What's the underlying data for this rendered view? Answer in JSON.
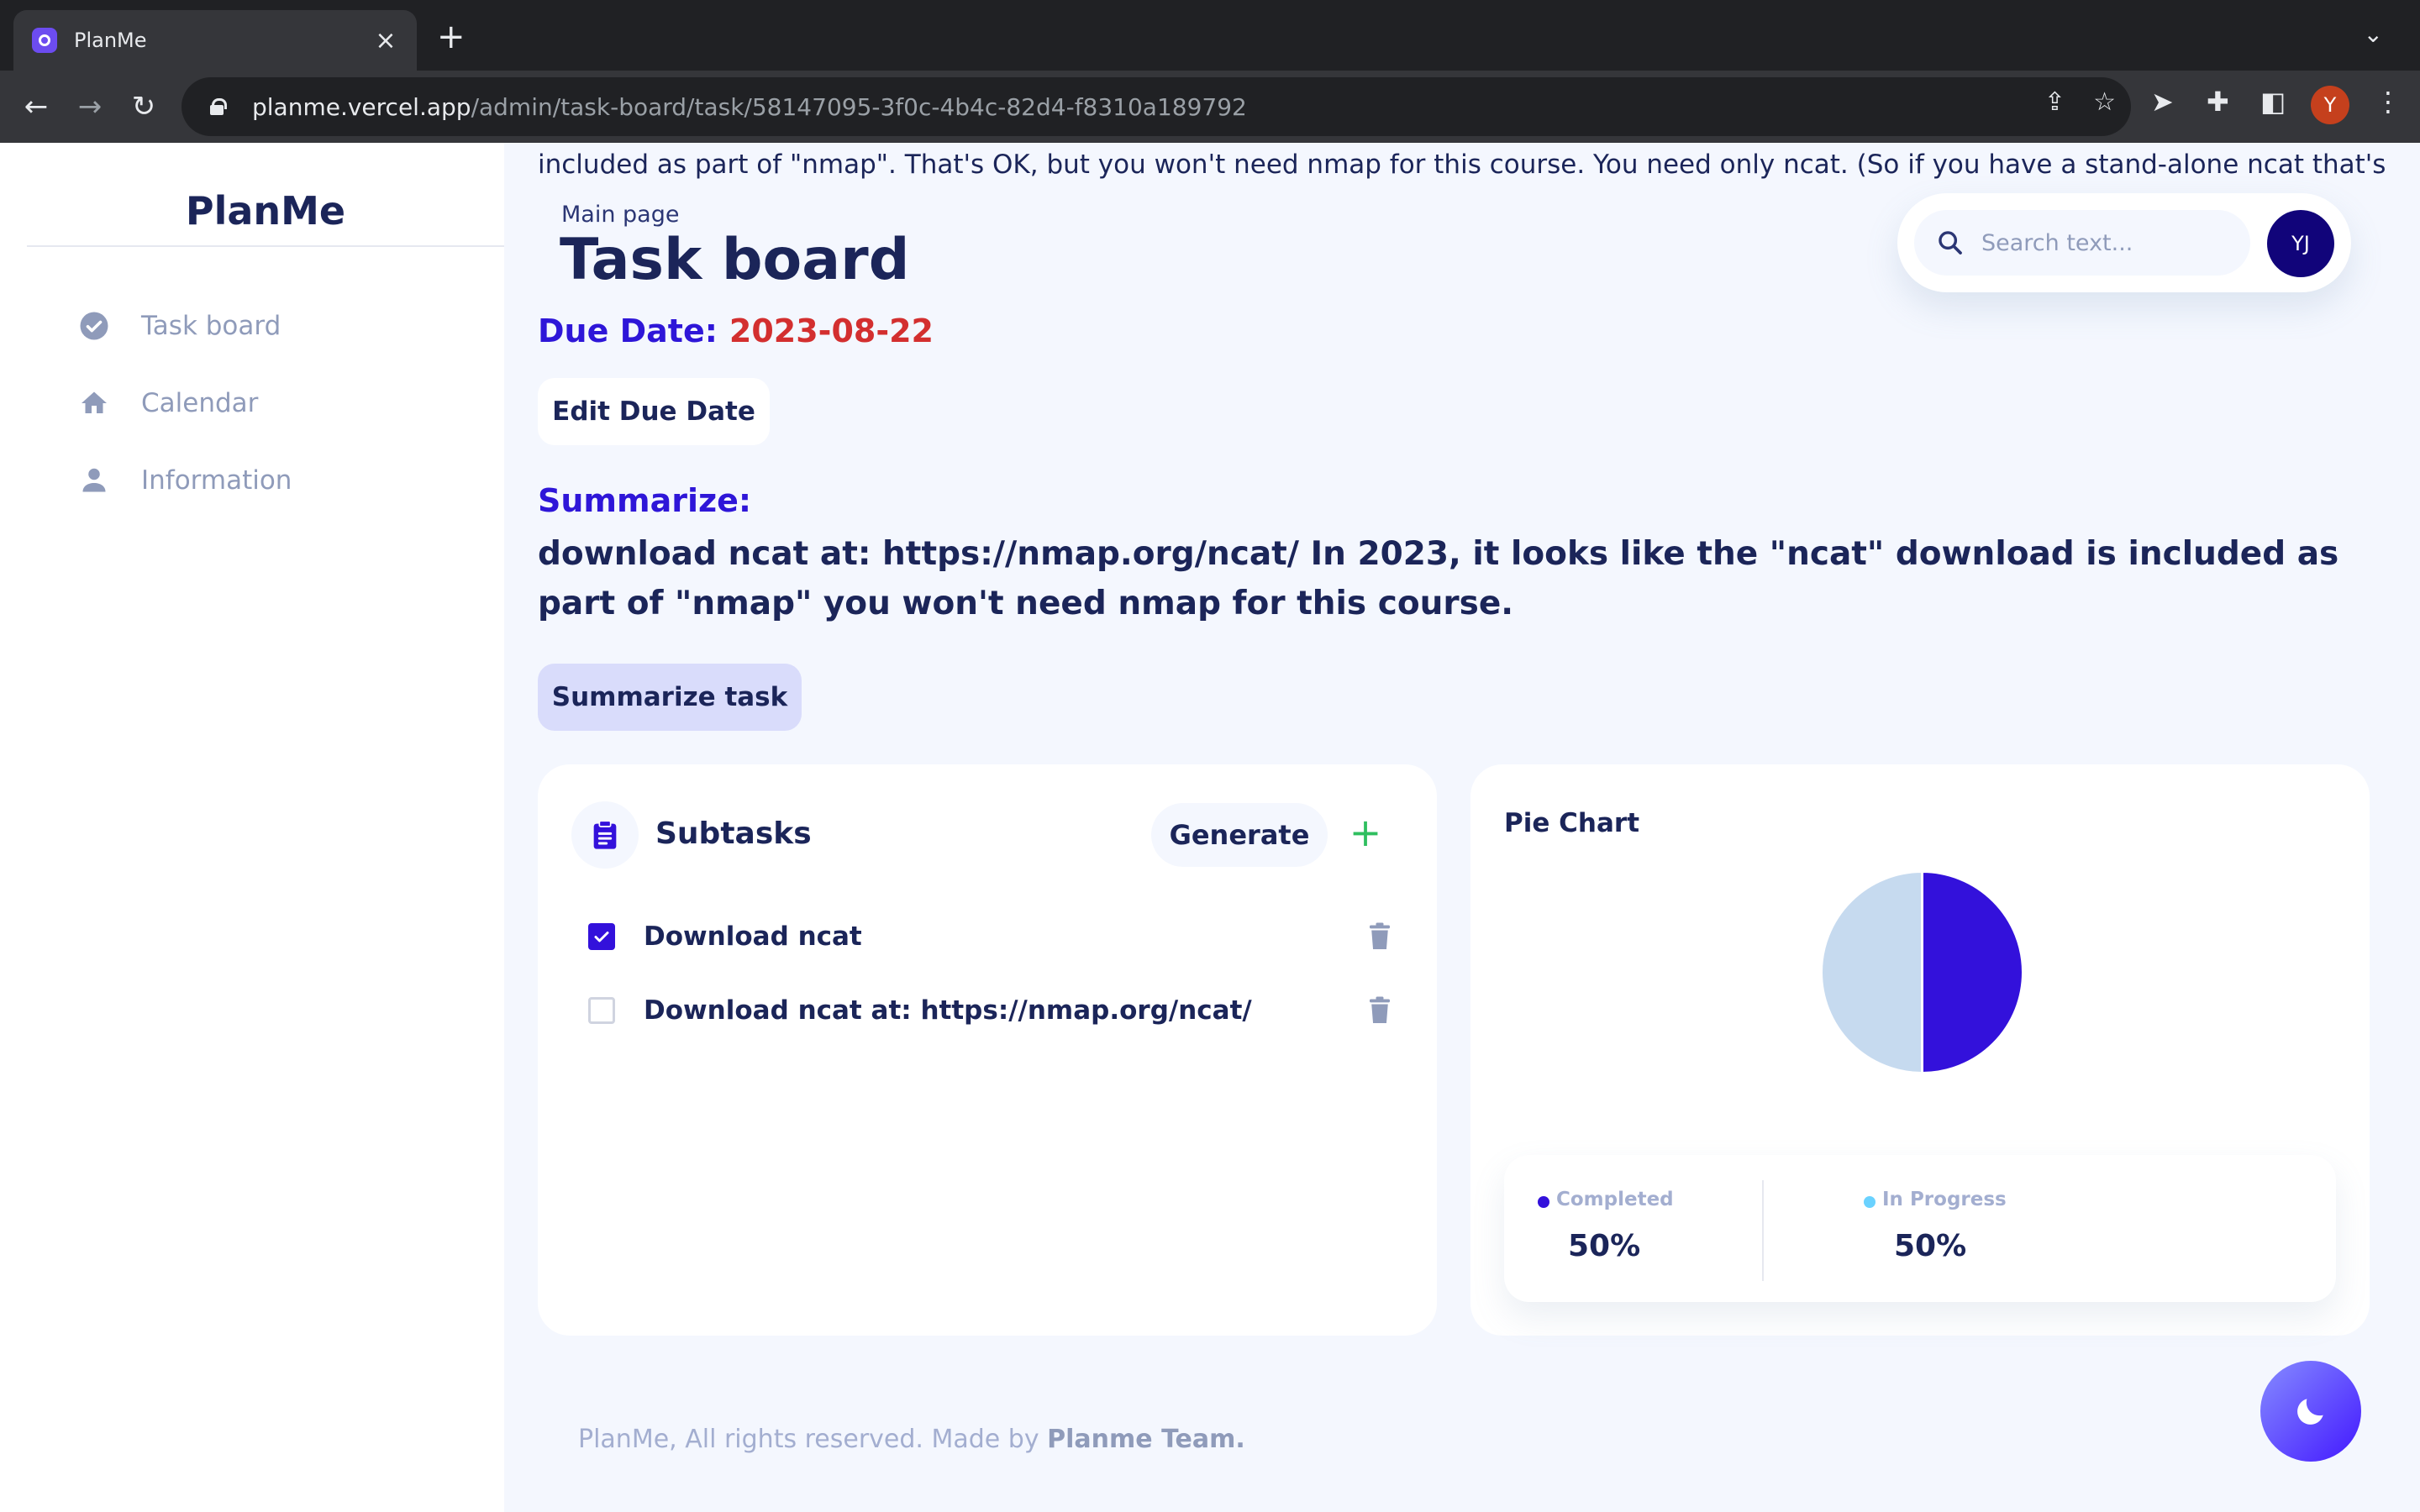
{
  "browser": {
    "tab_title": "PlanMe",
    "url_host": "planme.vercel.app",
    "url_path": "/admin/task-board/task/58147095-3f0c-4b4c-82d4-f8310a189792",
    "profile_initial": "Y"
  },
  "sidebar": {
    "brand": "PlanMe",
    "items": [
      {
        "label": "Task board",
        "icon": "check-circle-icon"
      },
      {
        "label": "Calendar",
        "icon": "home-icon"
      },
      {
        "label": "Information",
        "icon": "person-icon"
      }
    ]
  },
  "header": {
    "top_text": "included as part of \"nmap\". That's OK, but you won't need nmap for this course. You need only ncat. (So if you have a stand-alone ncat that's fine.)",
    "breadcrumb": "Main page",
    "title": "Task board",
    "search_placeholder": "Search text...",
    "avatar_initials": "YJ"
  },
  "task": {
    "due_label": "Due Date:",
    "due_value": "2023-08-22",
    "edit_due_button": "Edit Due Date",
    "summarize_label": "Summarize:",
    "summary": "download ncat at: https://nmap.org/ncat/ In 2023, it looks like the \"ncat\" download is included as part of \"nmap\" you won't need nmap for this course.",
    "summarize_button": "Summarize task"
  },
  "subtasks": {
    "title": "Subtasks",
    "generate_button": "Generate",
    "items": [
      {
        "label": "Download ncat",
        "done": true
      },
      {
        "label": "Download ncat at: https://nmap.org/ncat/",
        "done": false
      }
    ]
  },
  "pie": {
    "title": "Pie Chart",
    "completed_label": "Completed",
    "completed_value": "50%",
    "in_progress_label": "In Progress",
    "in_progress_value": "50%",
    "colors": {
      "completed": "#3311db",
      "in_progress": "#c6daef"
    }
  },
  "chart_data": {
    "type": "pie",
    "title": "Pie Chart",
    "categories": [
      "Completed",
      "In Progress"
    ],
    "values": [
      50,
      50
    ],
    "legend": "bottom"
  },
  "footer": {
    "text": "PlanMe, All rights reserved. Made by ",
    "team": "Planme Team."
  },
  "colors": {
    "accent": "#3311db",
    "due_date": "#d32f2f",
    "brand_text": "#1b2559"
  }
}
